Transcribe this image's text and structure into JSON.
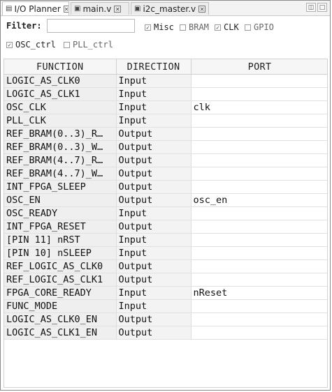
{
  "tabs": [
    {
      "label": "I/O Planner",
      "icon": "planner-icon",
      "active": true
    },
    {
      "label": "main.v",
      "icon": "verilog-file-icon",
      "active": false
    },
    {
      "label": "i2c_master.v",
      "icon": "verilog-file-icon",
      "active": false
    }
  ],
  "filter": {
    "label": "Filter:",
    "value": "",
    "placeholder": ""
  },
  "checkboxes": [
    {
      "label": "Misc",
      "checked": true
    },
    {
      "label": "BRAM",
      "checked": false
    },
    {
      "label": "CLK",
      "checked": true
    },
    {
      "label": "GPIO",
      "checked": false
    },
    {
      "label": "OSC_ctrl",
      "checked": true
    },
    {
      "label": "PLL_ctrl",
      "checked": false
    }
  ],
  "table": {
    "headers": [
      "FUNCTION",
      "DIRECTION",
      "PORT"
    ],
    "rows": [
      {
        "function": "LOGIC_AS_CLK0",
        "direction": "Input",
        "port": ""
      },
      {
        "function": "LOGIC_AS_CLK1",
        "direction": "Input",
        "port": ""
      },
      {
        "function": "OSC_CLK",
        "direction": "Input",
        "port": "clk"
      },
      {
        "function": "PLL_CLK",
        "direction": "Input",
        "port": ""
      },
      {
        "function": "REF_BRAM(0..3)_R…",
        "direction": "Output",
        "port": ""
      },
      {
        "function": "REF_BRAM(0..3)_W…",
        "direction": "Output",
        "port": ""
      },
      {
        "function": "REF_BRAM(4..7)_R…",
        "direction": "Output",
        "port": ""
      },
      {
        "function": "REF_BRAM(4..7)_W…",
        "direction": "Output",
        "port": ""
      },
      {
        "function": "INT_FPGA_SLEEP",
        "direction": "Output",
        "port": ""
      },
      {
        "function": "OSC_EN",
        "direction": "Output",
        "port": "osc_en"
      },
      {
        "function": "OSC_READY",
        "direction": "Input",
        "port": ""
      },
      {
        "function": "INT_FPGA_RESET",
        "direction": "Output",
        "port": ""
      },
      {
        "function": "[PIN 11] nRST",
        "direction": "Input",
        "port": ""
      },
      {
        "function": "[PIN 10] nSLEEP",
        "direction": "Input",
        "port": ""
      },
      {
        "function": "REF_LOGIC_AS_CLK0",
        "direction": "Output",
        "port": ""
      },
      {
        "function": "REF_LOGIC_AS_CLK1",
        "direction": "Output",
        "port": ""
      },
      {
        "function": "FPGA_CORE_READY",
        "direction": "Input",
        "port": "nReset"
      },
      {
        "function": "FUNC_MODE",
        "direction": "Input",
        "port": ""
      },
      {
        "function": "LOGIC_AS_CLK0_EN",
        "direction": "Output",
        "port": ""
      },
      {
        "function": "LOGIC_AS_CLK1_EN",
        "direction": "Output",
        "port": ""
      }
    ]
  }
}
